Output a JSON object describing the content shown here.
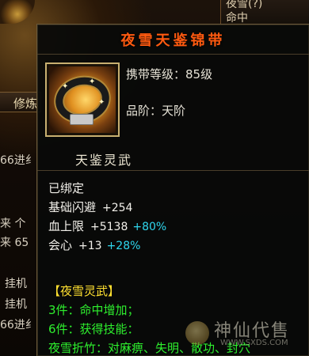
{
  "background": {
    "left_tab_label": "修炼",
    "left_lines": [
      "66进纟",
      "来 个",
      "来 65",
      "挂机",
      "挂机",
      "66进纟"
    ],
    "right_top": "夜雪(?)",
    "right_label": "命中"
  },
  "tooltip": {
    "title": "夜雪天鉴锦带",
    "icon": "belt-icon",
    "level_label": "携带等级：85级",
    "grade_label": "品阶：天阶",
    "set_name": "天鉴灵武",
    "bound": "已绑定",
    "stats": [
      {
        "name": "基础闪避",
        "value": "+254",
        "bonus": ""
      },
      {
        "name": "血上限",
        "value": "+5138",
        "bonus": "+80%"
      },
      {
        "name": "会心",
        "value": "+13",
        "bonus": "+28%"
      }
    ],
    "set_header": "【夜雪灵武】",
    "set_lines": [
      "3件：命中增加；",
      "6件：获得技能：",
      "夜雪折竹：对麻痹、失明、散功、封穴"
    ]
  },
  "watermark": {
    "name": "神仙代售",
    "url": "WWW.SXDS.COM"
  },
  "colors": {
    "title": "#ff5a10",
    "set_header": "#ffe030",
    "set_text": "#2ef02e",
    "bonus": "#2fd7ee"
  }
}
